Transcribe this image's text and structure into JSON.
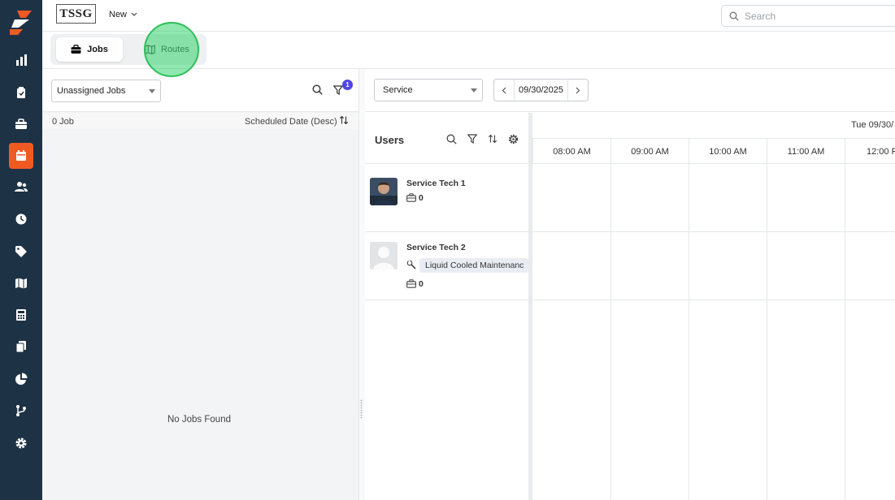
{
  "header": {
    "brand": "TSSG",
    "new_label": "New",
    "search_placeholder": "Search"
  },
  "tabs": [
    {
      "label": "Jobs",
      "active": true
    },
    {
      "label": "Routes",
      "active": false
    }
  ],
  "jobs_panel": {
    "filter_value": "Unassigned Jobs",
    "filter_badge": "1",
    "job_count": "0 Job",
    "sort_label": "Scheduled Date (Desc)",
    "empty_message": "No Jobs Found"
  },
  "scheduler": {
    "view_select": "Service",
    "date": "09/30/2025",
    "users_title": "Users",
    "day_label": "Tue 09/30/",
    "times": [
      "08:00 AM",
      "09:00 AM",
      "10:00 AM",
      "11:00 AM",
      "12:00 P"
    ],
    "users": [
      {
        "name": "Service Tech 1",
        "job_count": "0",
        "skill": ""
      },
      {
        "name": "Service Tech 2",
        "job_count": "0",
        "skill": "Liquid Cooled Maintenanc"
      }
    ]
  },
  "sidebar": {
    "active_item": "schedule-icon",
    "items": [
      "dashboard-icon",
      "jobs-icon",
      "briefcase-icon",
      "schedule-icon",
      "customers-icon",
      "clock-icon",
      "tag-icon",
      "map-icon",
      "calculator-icon",
      "documents-icon",
      "reports-icon",
      "workflow-icon",
      "settings-icon"
    ]
  },
  "colors": {
    "sidebar": "#1e3245",
    "accent": "#f05a22",
    "badge": "#4f46e5",
    "click_highlight": "#34d36e"
  }
}
